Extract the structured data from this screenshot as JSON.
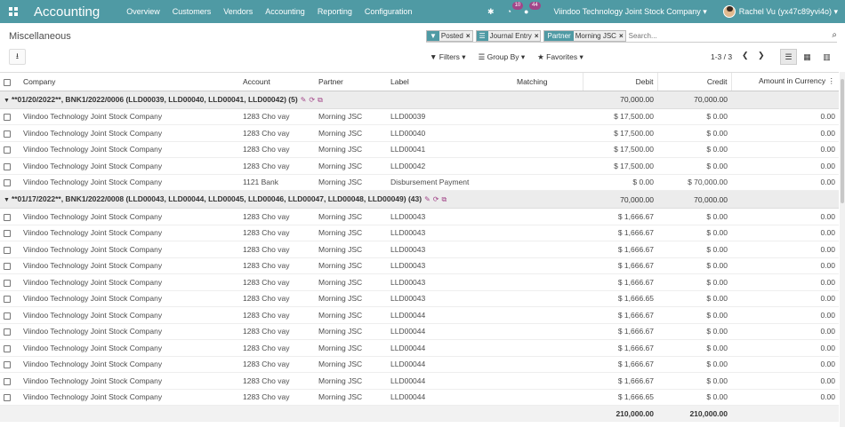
{
  "navbar": {
    "app_title": "Accounting",
    "menu": [
      "Overview",
      "Customers",
      "Vendors",
      "Accounting",
      "Reporting",
      "Configuration"
    ],
    "activity_count": "10",
    "message_count": "44",
    "company": "Viindoo Technology Joint Stock Company",
    "user": "Rachel Vu (yx47c89yvi4o)"
  },
  "control_panel": {
    "breadcrumb": "Miscellaneous",
    "facets": [
      {
        "label": "Posted"
      },
      {
        "label": "Journal Entry"
      },
      {
        "prefix": "Partner",
        "label": "Morning JSC"
      }
    ],
    "search_placeholder": "Search...",
    "filters_label": "Filters",
    "groupby_label": "Group By",
    "favorites_label": "Favorites",
    "pager": "1-3 / 3"
  },
  "table": {
    "columns": [
      "Company",
      "Account",
      "Partner",
      "Label",
      "Matching",
      "Debit",
      "Credit",
      "Amount in Currency"
    ],
    "groups": [
      {
        "title": "**01/20/2022**, BNK1/2022/0006 (LLD00039, LLD00040, LLD00041, LLD00042) (5)",
        "debit": "70,000.00",
        "credit": "70,000.00",
        "rows": [
          [
            "Viindoo Technology Joint Stock Company",
            "1283 Cho vay",
            "Morning JSC",
            "LLD00039",
            "",
            "$ 17,500.00",
            "$ 0.00",
            "0.00"
          ],
          [
            "Viindoo Technology Joint Stock Company",
            "1283 Cho vay",
            "Morning JSC",
            "LLD00040",
            "",
            "$ 17,500.00",
            "$ 0.00",
            "0.00"
          ],
          [
            "Viindoo Technology Joint Stock Company",
            "1283 Cho vay",
            "Morning JSC",
            "LLD00041",
            "",
            "$ 17,500.00",
            "$ 0.00",
            "0.00"
          ],
          [
            "Viindoo Technology Joint Stock Company",
            "1283 Cho vay",
            "Morning JSC",
            "LLD00042",
            "",
            "$ 17,500.00",
            "$ 0.00",
            "0.00"
          ],
          [
            "Viindoo Technology Joint Stock Company",
            "1121 Bank",
            "Morning JSC",
            "Disbursement Payment",
            "",
            "$ 0.00",
            "$ 70,000.00",
            "0.00"
          ]
        ]
      },
      {
        "title": "**01/17/2022**, BNK1/2022/0008 (LLD00043, LLD00044, LLD00045, LLD00046, LLD00047, LLD00048, LLD00049) (43)",
        "debit": "70,000.00",
        "credit": "70,000.00",
        "rows": [
          [
            "Viindoo Technology Joint Stock Company",
            "1283 Cho vay",
            "Morning JSC",
            "LLD00043",
            "",
            "$ 1,666.67",
            "$ 0.00",
            "0.00"
          ],
          [
            "Viindoo Technology Joint Stock Company",
            "1283 Cho vay",
            "Morning JSC",
            "LLD00043",
            "",
            "$ 1,666.67",
            "$ 0.00",
            "0.00"
          ],
          [
            "Viindoo Technology Joint Stock Company",
            "1283 Cho vay",
            "Morning JSC",
            "LLD00043",
            "",
            "$ 1,666.67",
            "$ 0.00",
            "0.00"
          ],
          [
            "Viindoo Technology Joint Stock Company",
            "1283 Cho vay",
            "Morning JSC",
            "LLD00043",
            "",
            "$ 1,666.67",
            "$ 0.00",
            "0.00"
          ],
          [
            "Viindoo Technology Joint Stock Company",
            "1283 Cho vay",
            "Morning JSC",
            "LLD00043",
            "",
            "$ 1,666.67",
            "$ 0.00",
            "0.00"
          ],
          [
            "Viindoo Technology Joint Stock Company",
            "1283 Cho vay",
            "Morning JSC",
            "LLD00043",
            "",
            "$ 1,666.65",
            "$ 0.00",
            "0.00"
          ],
          [
            "Viindoo Technology Joint Stock Company",
            "1283 Cho vay",
            "Morning JSC",
            "LLD00044",
            "",
            "$ 1,666.67",
            "$ 0.00",
            "0.00"
          ],
          [
            "Viindoo Technology Joint Stock Company",
            "1283 Cho vay",
            "Morning JSC",
            "LLD00044",
            "",
            "$ 1,666.67",
            "$ 0.00",
            "0.00"
          ],
          [
            "Viindoo Technology Joint Stock Company",
            "1283 Cho vay",
            "Morning JSC",
            "LLD00044",
            "",
            "$ 1,666.67",
            "$ 0.00",
            "0.00"
          ],
          [
            "Viindoo Technology Joint Stock Company",
            "1283 Cho vay",
            "Morning JSC",
            "LLD00044",
            "",
            "$ 1,666.67",
            "$ 0.00",
            "0.00"
          ],
          [
            "Viindoo Technology Joint Stock Company",
            "1283 Cho vay",
            "Morning JSC",
            "LLD00044",
            "",
            "$ 1,666.67",
            "$ 0.00",
            "0.00"
          ],
          [
            "Viindoo Technology Joint Stock Company",
            "1283 Cho vay",
            "Morning JSC",
            "LLD00044",
            "",
            "$ 1,666.65",
            "$ 0.00",
            "0.00"
          ]
        ]
      }
    ],
    "totals": {
      "debit": "210,000.00",
      "credit": "210,000.00"
    }
  },
  "colors": {
    "navbar": "#4f9aa4",
    "badge": "#a24689",
    "group_bg": "#ececec"
  }
}
